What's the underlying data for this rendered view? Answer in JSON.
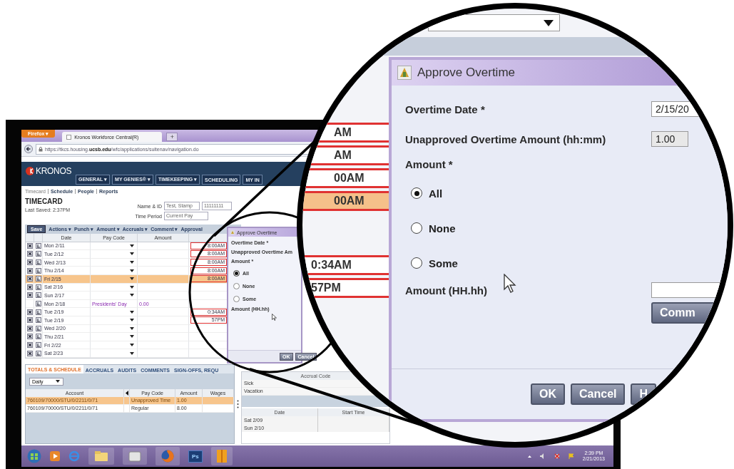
{
  "browser": {
    "menu_button": "Firefox ▾",
    "tab_title": "Kronos Workforce Central(R)",
    "new_tab": "+",
    "url": "https://tkcs.housing.**ucsb.edu**/wfc/applications/suitenav/navigation.do"
  },
  "header": {
    "logo": "KRONOS",
    "nav": [
      {
        "label": "GENERAL ▾"
      },
      {
        "label": "MY GENIES® ▾"
      },
      {
        "label": "TIMEKEEPING ▾"
      },
      {
        "label": "SCHEDULING"
      },
      {
        "label": "MY IN"
      }
    ]
  },
  "links": [
    {
      "label": "Timecard",
      "selected": true
    },
    {
      "label": "Schedule",
      "selected": false
    },
    {
      "label": "People",
      "selected": false
    },
    {
      "label": "Reports",
      "selected": false
    }
  ],
  "timecard": {
    "title": "TIMECARD",
    "last_saved": "Last Saved: 2:37PM",
    "name_label": "Name & ID",
    "name": "Test, Stamp",
    "id": "11111111",
    "period_label": "Time Period",
    "period": "Current Pay"
  },
  "toolbar": {
    "save": "Save",
    "menus": [
      "Actions ▾",
      "Punch ▾",
      "Amount ▾",
      "Accruals ▾",
      "Comment ▾",
      "Approval"
    ]
  },
  "grid": {
    "columns": [
      "Date",
      "Pay Code",
      "Amount"
    ],
    "rows": [
      {
        "date": "Mon 2/11",
        "in": "8:00AM",
        "selected": false,
        "deletable": true
      },
      {
        "date": "Tue 2/12",
        "in": "8:00AM",
        "selected": false,
        "deletable": true
      },
      {
        "date": "Wed 2/13",
        "in": "8:00AM",
        "selected": false,
        "deletable": true
      },
      {
        "date": "Thu 2/14",
        "in": "8:00AM",
        "selected": false,
        "deletable": true
      },
      {
        "date": "Fri 2/15",
        "in": "8:00AM",
        "selected": true,
        "deletable": true
      },
      {
        "date": "Sat 2/16",
        "selected": false,
        "deletable": true
      },
      {
        "date": "Sun 2/17",
        "selected": false,
        "deletable": true
      },
      {
        "date": "Mon 2/18",
        "pay_code": "Presidents' Day",
        "amount": "0.00",
        "selected": false,
        "deletable": false
      },
      {
        "date": "Tue 2/19",
        "in": "0:34AM",
        "selected": false,
        "deletable": true
      },
      {
        "date": "Tue 2/19",
        "in": "57PM",
        "selected": false,
        "deletable": true
      },
      {
        "date": "Wed 2/20",
        "selected": false,
        "deletable": true
      },
      {
        "date": "Thu 2/21",
        "selected": false,
        "deletable": true
      },
      {
        "date": "Fri 2/22",
        "selected": false,
        "deletable": true
      },
      {
        "date": "Sat 2/23",
        "selected": false,
        "deletable": true
      }
    ]
  },
  "totals": {
    "tabs": [
      {
        "label": "TOTALS & SCHEDULE",
        "selected": true
      },
      {
        "label": "ACCRUALS",
        "selected": false
      },
      {
        "label": "AUDITS",
        "selected": false
      },
      {
        "label": "COMMENTS",
        "selected": false
      },
      {
        "label": "SIGN-OFFS, REQU",
        "selected": false
      }
    ],
    "period": "Daily",
    "columns": [
      "Account",
      "Pay Code",
      "Amount",
      "Wages"
    ],
    "rows": [
      {
        "account": "760109/70000/STU/0/2211/0/71",
        "pay_code": "Unapproved Time",
        "amount": "1.00",
        "selected": true
      },
      {
        "account": "760109/70000/STU/0/2211/0/71",
        "pay_code": "Regular",
        "amount": "8.00",
        "selected": false
      }
    ]
  },
  "accruals": {
    "column": "Accrual Code",
    "rows": [
      "Sick",
      "Vacation"
    ]
  },
  "schedule": {
    "columns": [
      "Date",
      "Start Time"
    ],
    "rows": [
      "Sat 2/09",
      "Sun 2/10"
    ]
  },
  "taskbar": {
    "icon_label": "Ps",
    "time": "2:39 PM",
    "date": "2/21/2013"
  },
  "small_dialog": {
    "title": "Approve Overtime",
    "date_label": "Overtime Date *",
    "amount_label": "Unapproved Overtime Am",
    "choice_label": "Amount *",
    "options": [
      {
        "label": "All",
        "selected": true
      },
      {
        "label": "None",
        "selected": false
      },
      {
        "label": "Some",
        "selected": false
      }
    ],
    "hours_label": "Amount (HH.hh)",
    "buttons": [
      "OK",
      "Cancel"
    ]
  },
  "magnifier": {
    "punches_top": [
      {
        "text": "AM",
        "selected": false
      },
      {
        "text": "AM",
        "selected": false
      },
      {
        "text": "00AM",
        "selected": false
      },
      {
        "text": "00AM",
        "selected": true
      }
    ],
    "punches_bottom": [
      "0:34AM",
      "57PM"
    ],
    "dialog": {
      "title": "Approve Overtime",
      "date_label": "Overtime Date *",
      "date": "2/15/20",
      "amount_label": "Unapproved Overtime Amount (hh:mm)",
      "amount": "1.00",
      "choice_label": "Amount *",
      "options": [
        {
          "label": "All",
          "selected": true
        },
        {
          "label": "None",
          "selected": false
        },
        {
          "label": "Some",
          "selected": false
        }
      ],
      "hours_label": "Amount (HH.hh)",
      "comment_button": "Comm",
      "buttons": [
        "OK",
        "Cancel",
        "H"
      ]
    }
  }
}
